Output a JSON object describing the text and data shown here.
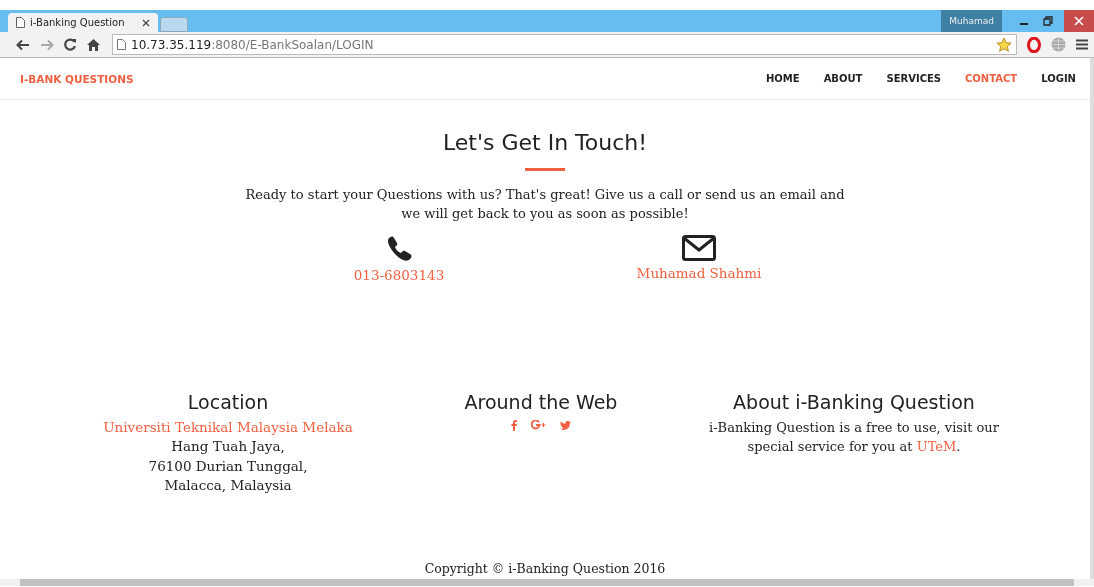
{
  "browser": {
    "tab_title": "i-Banking Question",
    "profile": "Muhamad",
    "address_host": "10.73.35.119",
    "address_rest": ":8080/E-BankSoalan/LOGIN"
  },
  "navbar": {
    "brand": "I-BANK QUESTIONS",
    "items": [
      {
        "label": "HOME",
        "selected": false
      },
      {
        "label": "ABOUT",
        "selected": false
      },
      {
        "label": "SERVICES",
        "selected": false
      },
      {
        "label": "CONTACT",
        "selected": true
      },
      {
        "label": "LOGIN",
        "selected": false
      }
    ]
  },
  "contact": {
    "heading": "Let's Get In Touch!",
    "text": "Ready to start your Questions with us? That's great! Give us a call or send us an email and we will get back to you as soon as possible!",
    "items": [
      {
        "kind": "phone",
        "label": "013-6803143"
      },
      {
        "kind": "email",
        "label": "Muhamad Shahmi"
      }
    ]
  },
  "footer": {
    "location": {
      "heading": "Location",
      "link": "Universiti Teknikal Malaysia Melaka",
      "lines": [
        "Hang Tuah Jaya,",
        "76100 Durian Tunggal,",
        "Malacca, Malaysia"
      ]
    },
    "web": {
      "heading": "Around the Web",
      "links": [
        {
          "kind": "facebook"
        },
        {
          "kind": "googleplus"
        },
        {
          "kind": "twitter"
        }
      ]
    },
    "about": {
      "heading": "About i-Banking Question",
      "text": "i-Banking Question is a free to use, visit our special service for you at ",
      "link": "UTeM",
      "after": "."
    },
    "copyright": "Copyright © i-Banking Question 2016"
  }
}
